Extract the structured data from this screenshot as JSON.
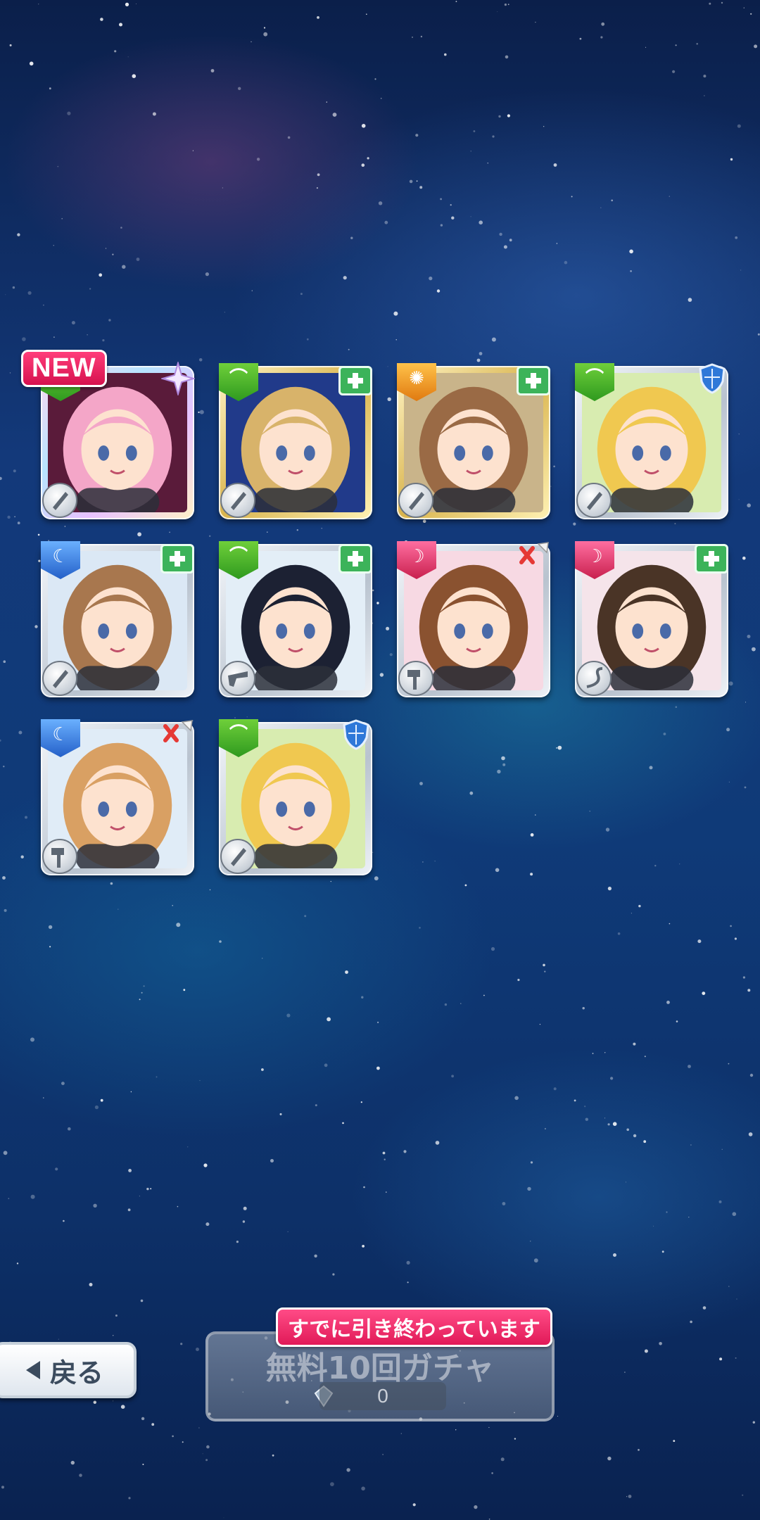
{
  "badges": {
    "new_label": "NEW"
  },
  "cards": [
    {
      "attribute": "green",
      "role": "star",
      "weapon": "knife",
      "frame": "rainbow",
      "hair": "#f4a6c8",
      "bg": "#5a1b3a"
    },
    {
      "attribute": "green",
      "role": "heal",
      "weapon": "knife",
      "frame": "gold",
      "hair": "#d8b36a",
      "bg": "#213a8a"
    },
    {
      "attribute": "orange",
      "role": "heal",
      "weapon": "knife",
      "frame": "gold",
      "hair": "#9a6a45",
      "bg": "#c9b48a"
    },
    {
      "attribute": "green",
      "role": "shield",
      "weapon": "knife",
      "frame": "silver",
      "hair": "#f0c850",
      "bg": "#d8ecb0"
    },
    {
      "attribute": "blue",
      "role": "heal",
      "weapon": "knife",
      "frame": "silver",
      "hair": "#a8774e",
      "bg": "#dbe8f5"
    },
    {
      "attribute": "green",
      "role": "heal",
      "weapon": "gun",
      "frame": "silver",
      "hair": "#1c2133",
      "bg": "#e3eef7"
    },
    {
      "attribute": "pink",
      "role": "attack",
      "weapon": "hammer",
      "frame": "silver",
      "hair": "#8a5230",
      "bg": "#f7d9e3"
    },
    {
      "attribute": "pink",
      "role": "heal",
      "weapon": "whip",
      "frame": "silver",
      "hair": "#4a3426",
      "bg": "#f5e4ea"
    },
    {
      "attribute": "blue",
      "role": "attack",
      "weapon": "hammer",
      "frame": "silver",
      "hair": "#d9a063",
      "bg": "#e0ecf7"
    },
    {
      "attribute": "green",
      "role": "shield",
      "weapon": "knife",
      "frame": "silver",
      "hair": "#f0c850",
      "bg": "#d8ecb0"
    }
  ],
  "buttons": {
    "back_label": "戻る",
    "gacha_label": "無料10回ガチャ",
    "gacha_cost": "0",
    "gacha_status": "すでに引き終わっています"
  },
  "colors": {
    "new_badge": "#e8185a",
    "heal": "#3cb35a",
    "attack": "#e53935",
    "shield": "#2f78d8"
  }
}
